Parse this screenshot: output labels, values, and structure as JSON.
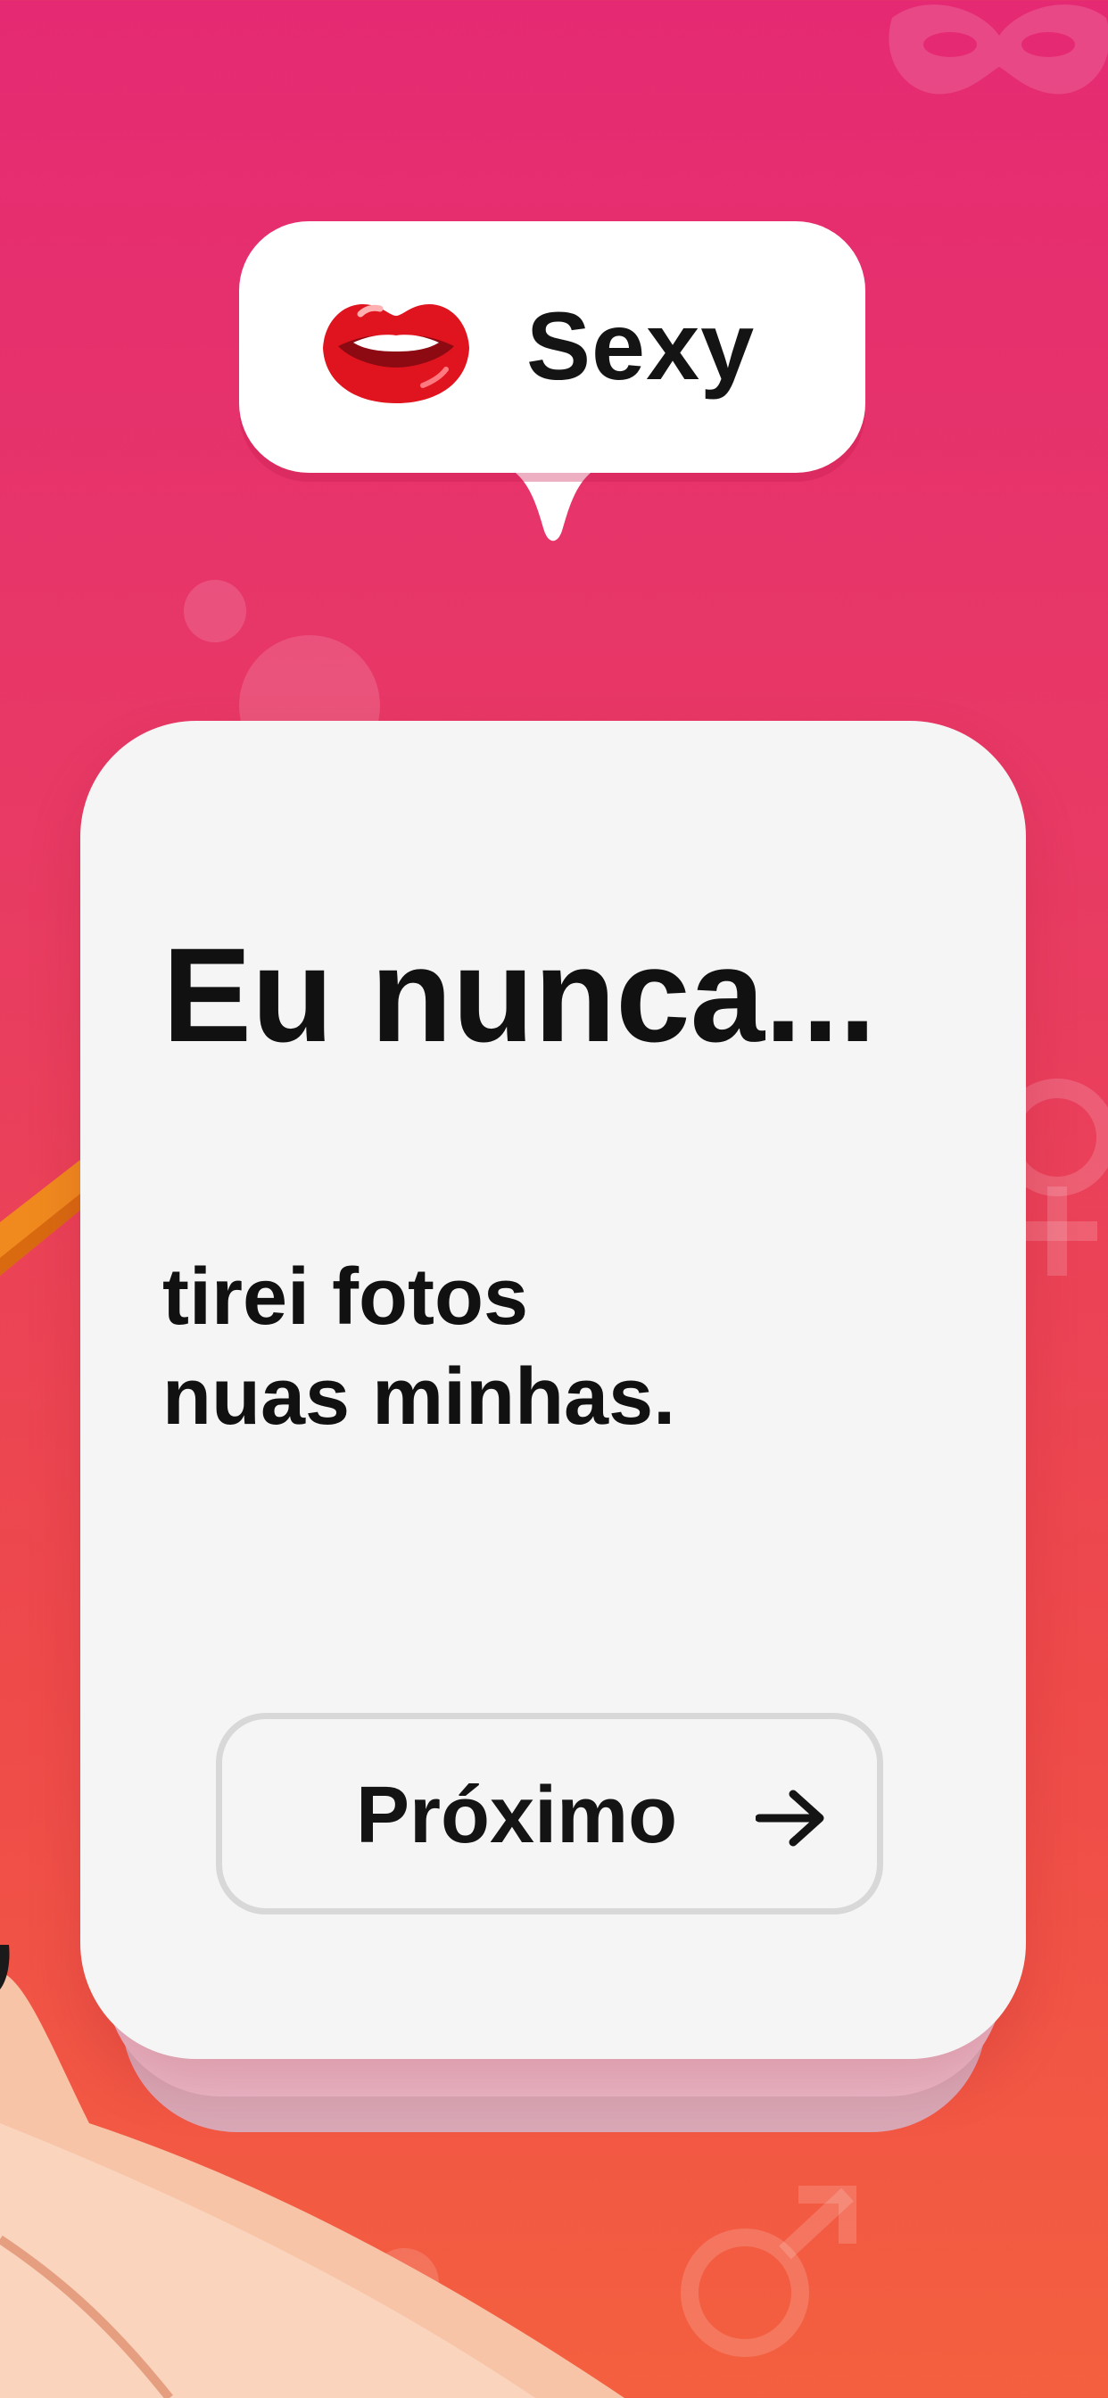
{
  "category": {
    "label": "Sexy",
    "icon": "lips-icon"
  },
  "card": {
    "title": "Eu nunca...",
    "statement_line1": "tirei fotos",
    "statement_line2": "nuas minhas."
  },
  "next_button": {
    "label": "Próximo",
    "icon": "arrow-right-icon"
  },
  "decorations": {
    "mask_icon": "mask-icon",
    "female_symbol_icon": "female-symbol-icon",
    "male_symbol_icon": "male-symbol-icon",
    "hand_icon": "hand-icon"
  },
  "colors": {
    "background_top": "#e52a73",
    "background_bottom": "#f4603f",
    "card": "#f5f5f5",
    "text": "#111111",
    "lips": "#e0141e"
  }
}
